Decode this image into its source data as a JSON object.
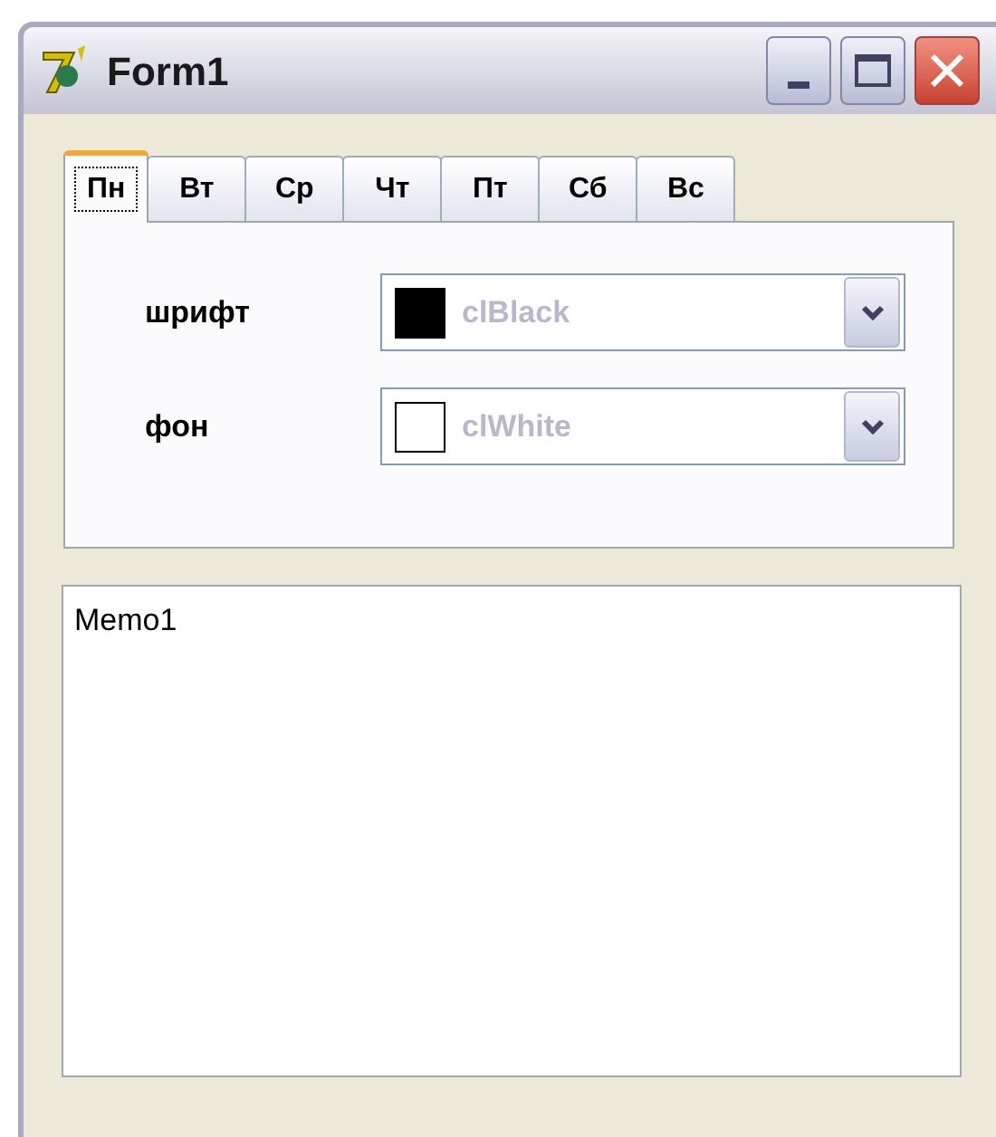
{
  "window": {
    "title": "Form1"
  },
  "tabs": [
    {
      "label": "Пн",
      "selected": true
    },
    {
      "label": "Вт",
      "selected": false
    },
    {
      "label": "Ср",
      "selected": false
    },
    {
      "label": "Чт",
      "selected": false
    },
    {
      "label": "Пт",
      "selected": false
    },
    {
      "label": "Сб",
      "selected": false
    },
    {
      "label": "Вс",
      "selected": false
    }
  ],
  "fields": [
    {
      "label": "шрифт",
      "value": "clBlack",
      "color": "#000000",
      "disabled": true
    },
    {
      "label": "фон",
      "value": "clWhite",
      "color": "#ffffff",
      "disabled": true
    }
  ],
  "memo": {
    "value": "Memo1"
  }
}
